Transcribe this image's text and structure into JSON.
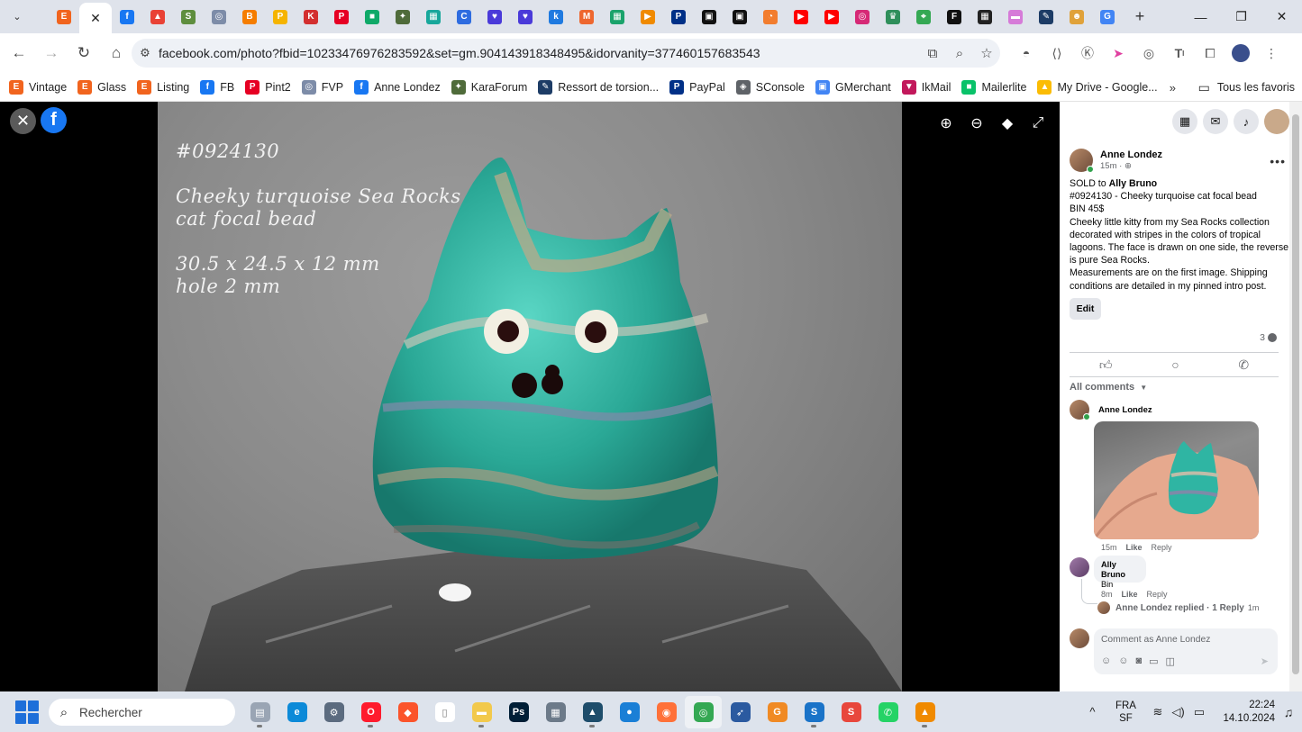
{
  "browser": {
    "tabs": [
      {
        "icon": "etsy-icon",
        "glyph": "E",
        "color": "#f1641e"
      },
      {
        "icon": "close-icon",
        "glyph": "✕",
        "color": "#ffffff",
        "active": true
      },
      {
        "icon": "facebook-icon",
        "glyph": "f",
        "color": "#1877f2"
      },
      {
        "icon": "drive-triangle-icon",
        "glyph": "▲",
        "color": "#e94235"
      },
      {
        "icon": "shopify-icon",
        "glyph": "S",
        "color": "#5e8e3e"
      },
      {
        "icon": "fvp-icon",
        "glyph": "◎",
        "color": "#7d8ca8"
      },
      {
        "icon": "blogger-icon",
        "glyph": "B",
        "color": "#f57d00"
      },
      {
        "icon": "paypal-p-icon",
        "glyph": "P",
        "color": "#f5b400"
      },
      {
        "icon": "k-red-icon",
        "glyph": "K",
        "color": "#d32f2f"
      },
      {
        "icon": "pinterest-icon",
        "glyph": "P",
        "color": "#e60023"
      },
      {
        "icon": "chat-green-icon",
        "glyph": "■",
        "color": "#0fa968"
      },
      {
        "icon": "turtle-icon",
        "glyph": "✦",
        "color": "#4f6b3a"
      },
      {
        "icon": "grid-teal-icon",
        "glyph": "▦",
        "color": "#17a79b"
      },
      {
        "icon": "circle-c-icon",
        "glyph": "C",
        "color": "#2e6ce0"
      },
      {
        "icon": "heart-shield-icon",
        "glyph": "♥",
        "color": "#4a3ad9"
      },
      {
        "icon": "heart-shield-icon",
        "glyph": "♥",
        "color": "#4a3ad9"
      },
      {
        "icon": "k-blue-icon",
        "glyph": "k",
        "color": "#1f7ae0"
      },
      {
        "icon": "magento-icon",
        "glyph": "M",
        "color": "#ee672f"
      },
      {
        "icon": "grid-green-icon",
        "glyph": "▦",
        "color": "#1aa36b"
      },
      {
        "icon": "play-orange-icon",
        "glyph": "▶",
        "color": "#f08a00"
      },
      {
        "icon": "paypal-icon",
        "glyph": "P",
        "color": "#003087"
      },
      {
        "icon": "photo-dark-icon",
        "glyph": "▣",
        "color": "#111111"
      },
      {
        "icon": "photo-dark-icon",
        "glyph": "▣",
        "color": "#111111"
      },
      {
        "icon": "timer-orange-icon",
        "glyph": "◔",
        "color": "#f27d2e"
      },
      {
        "icon": "youtube-icon",
        "glyph": "▶",
        "color": "#ff0000"
      },
      {
        "icon": "youtube-icon",
        "glyph": "▶",
        "color": "#ff0000"
      },
      {
        "icon": "instagram-icon",
        "glyph": "◎",
        "color": "#d62976"
      },
      {
        "icon": "crown-icon",
        "glyph": "♛",
        "color": "#2f8f5b"
      },
      {
        "icon": "maps-icon",
        "glyph": "⌖",
        "color": "#34a853"
      },
      {
        "icon": "f-circle-icon",
        "glyph": "F",
        "color": "#111111"
      },
      {
        "icon": "qr-icon",
        "glyph": "▦",
        "color": "#222222"
      },
      {
        "icon": "eraser-icon",
        "glyph": "▬",
        "color": "#d67bd8"
      },
      {
        "icon": "pen-icon",
        "glyph": "✎",
        "color": "#1d3c66"
      },
      {
        "icon": "emoji-icon",
        "glyph": "☻",
        "color": "#e0a23a"
      },
      {
        "icon": "google-icon",
        "glyph": "G",
        "color": "#4285f4"
      }
    ],
    "url": "facebook.com/photo?fbid=10233476976283592&set=gm.904143918348495&idorvanity=377460157683543",
    "bookmarks": [
      {
        "label": "Vintage",
        "icon": "etsy-icon",
        "glyph": "E",
        "color": "#f1641e"
      },
      {
        "label": "Glass",
        "icon": "etsy-icon",
        "glyph": "E",
        "color": "#f1641e"
      },
      {
        "label": "Listing",
        "icon": "etsy-icon",
        "glyph": "E",
        "color": "#f1641e"
      },
      {
        "label": "FB",
        "icon": "facebook-icon",
        "glyph": "f",
        "color": "#1877f2"
      },
      {
        "label": "Pint2",
        "icon": "pinterest-icon",
        "glyph": "P",
        "color": "#e60023"
      },
      {
        "label": "FVP",
        "icon": "fvp-icon",
        "glyph": "◎",
        "color": "#7d8ca8"
      },
      {
        "label": "Anne Londez",
        "icon": "facebook-icon",
        "glyph": "f",
        "color": "#1877f2"
      },
      {
        "label": "KaraForum",
        "icon": "turtle-icon",
        "glyph": "✦",
        "color": "#4f6b3a"
      },
      {
        "label": "Ressort de torsion...",
        "icon": "pen-icon",
        "glyph": "✎",
        "color": "#1d3c66"
      },
      {
        "label": "PayPal",
        "icon": "paypal-icon",
        "glyph": "P",
        "color": "#003087"
      },
      {
        "label": "SConsole",
        "icon": "search-console-icon",
        "glyph": "◈",
        "color": "#5f6368"
      },
      {
        "label": "GMerchant",
        "icon": "merchant-icon",
        "glyph": "▣",
        "color": "#4285f4"
      },
      {
        "label": "IkMail",
        "icon": "ikmail-icon",
        "glyph": "▼",
        "color": "#c2185b"
      },
      {
        "label": "Mailerlite",
        "icon": "mailerlite-icon",
        "glyph": "■",
        "color": "#09c269"
      },
      {
        "label": "My Drive - Google...",
        "icon": "drive-icon",
        "glyph": "▲",
        "color": "#fbbc04"
      }
    ],
    "bookmarks_more": "»",
    "all_bookmarks": "Tous les favoris"
  },
  "photo_overlay": {
    "id": "#0924130",
    "line1": "Cheeky turquoise Sea Rocks",
    "line2": "cat focal bead",
    "line3": "30.5 x 24.5 x 12 mm",
    "line4": "hole 2 mm"
  },
  "post": {
    "author": "Anne Londez",
    "time": "15m · ",
    "sold_prefix": "SOLD to ",
    "sold_to": "Ally Bruno",
    "lines": [
      "#0924130 - Cheeky turquoise cat focal bead",
      "BIN 45$",
      "Cheeky little kitty from my Sea Rocks collection decorated with stripes in the colors of tropical lagoons. The face is drawn on one side, the reverse is pure Sea Rocks.",
      "Measurements are on the first image. Shipping conditions are detailed in my pinned intro post."
    ],
    "edit_label": "Edit",
    "comment_count": "3"
  },
  "comments": {
    "filter_label": "All comments",
    "first": {
      "author": "Anne Londez",
      "time": "15m",
      "like": "Like",
      "reply": "Reply"
    },
    "second": {
      "author": "Ally Bruno",
      "text": "Bin",
      "time": "8m",
      "like": "Like",
      "reply": "Reply"
    },
    "replied": {
      "text": "Anne Londez replied · 1 Reply",
      "time": "1m"
    },
    "placeholder": "Comment as Anne Londez"
  },
  "taskbar": {
    "search_placeholder": "Rechercher",
    "lang_top": "FRA",
    "lang_bottom": "SF",
    "time": "22:24",
    "date": "14.10.2024",
    "apps": [
      {
        "icon": "files-icon",
        "glyph": "▤",
        "color": "#9aa5b4"
      },
      {
        "icon": "edge-icon",
        "glyph": "e",
        "color": "#0c8ad8"
      },
      {
        "icon": "settings-icon",
        "glyph": "⚙",
        "color": "#5b6b7f"
      },
      {
        "icon": "opera-icon",
        "glyph": "O",
        "color": "#ff1b2d"
      },
      {
        "icon": "brave-icon",
        "glyph": "◆",
        "color": "#fb542b"
      },
      {
        "icon": "document-icon",
        "glyph": "▯",
        "color": "#ffffff"
      },
      {
        "icon": "folder-icon",
        "glyph": "▬",
        "color": "#f2c94c"
      },
      {
        "icon": "photoshop-icon",
        "glyph": "Ps",
        "color": "#001e36"
      },
      {
        "icon": "calculator-icon",
        "glyph": "▦",
        "color": "#6c7a89"
      },
      {
        "icon": "terminal-icon",
        "glyph": "▲",
        "color": "#1e4d6b"
      },
      {
        "icon": "store-icon",
        "glyph": "●",
        "color": "#1a7fd6"
      },
      {
        "icon": "firefox-icon",
        "glyph": "◉",
        "color": "#ff7139"
      },
      {
        "icon": "chrome-icon",
        "glyph": "◎",
        "color": "#34a853"
      },
      {
        "icon": "feather-icon",
        "glyph": "➶",
        "color": "#2b5aa0"
      },
      {
        "icon": "sublime-icon",
        "glyph": "G",
        "color": "#f08a24"
      },
      {
        "icon": "s-blue-icon",
        "glyph": "S",
        "color": "#1a73c8"
      },
      {
        "icon": "s-red-icon",
        "glyph": "S",
        "color": "#e8473c"
      },
      {
        "icon": "whatsapp-icon",
        "glyph": "✆",
        "color": "#25d366"
      },
      {
        "icon": "vlc-icon",
        "glyph": "▲",
        "color": "#f08a00"
      }
    ]
  },
  "colors": {
    "facebook_blue": "#1877f2",
    "online_green": "#31a24c",
    "turquoise": "#29b6a6"
  }
}
